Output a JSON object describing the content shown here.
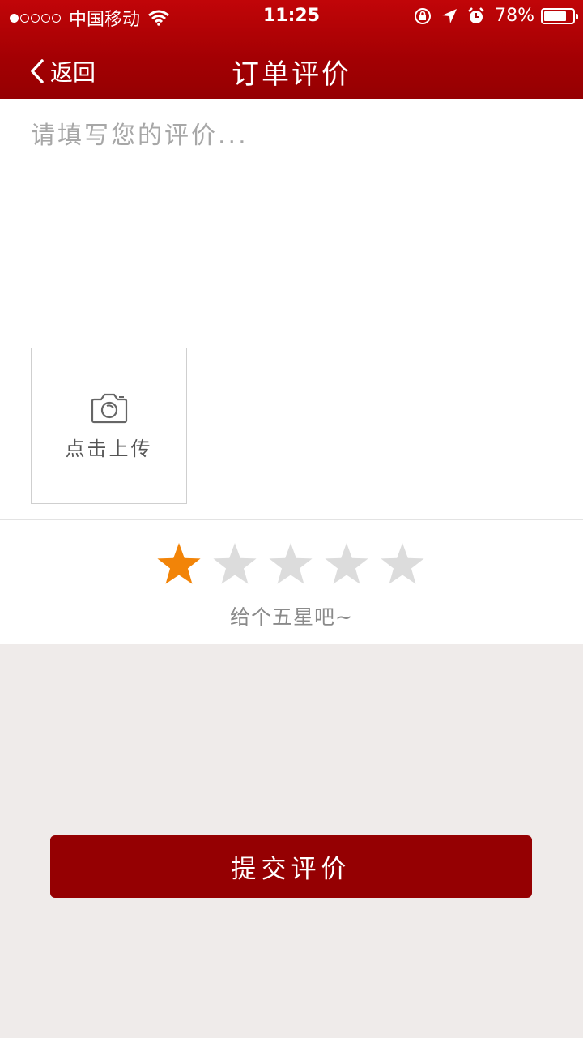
{
  "status_bar": {
    "carrier": "中国移动",
    "signal_dots_filled": 1,
    "signal_dots_total": 5,
    "time": "11:25",
    "battery_percent_text": "78%",
    "battery_level": 0.78
  },
  "nav": {
    "back_label": "返回",
    "title": "订单评价"
  },
  "review": {
    "placeholder": "请填写您的评价...",
    "value": ""
  },
  "upload": {
    "label": "点击上传"
  },
  "rating": {
    "max": 5,
    "value": 1,
    "hint": "给个五星吧~",
    "color_active": "#f28408",
    "color_inactive": "#dcdcdc"
  },
  "submit": {
    "label": "提交评价"
  },
  "colors": {
    "brand_red": "#950002",
    "page_bg": "#efebea"
  }
}
